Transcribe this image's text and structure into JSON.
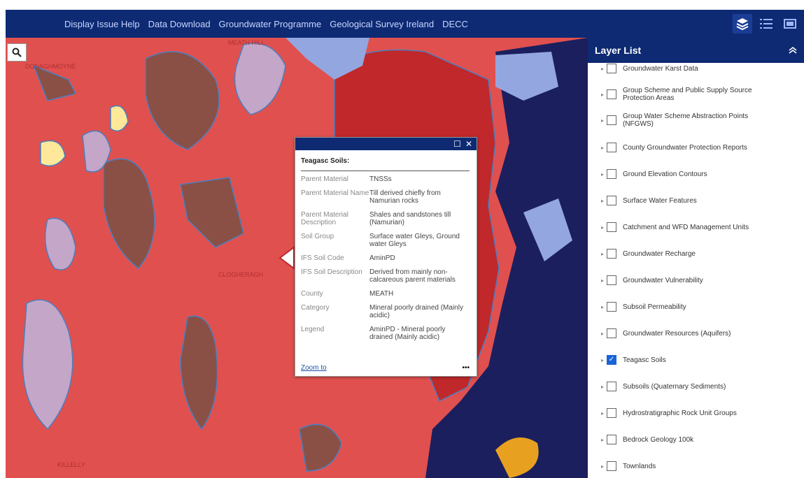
{
  "nav": {
    "links": [
      "Display Issue Help",
      "Data Download",
      "Groundwater Programme",
      "Geological Survey Ireland",
      "DECC"
    ],
    "tools": [
      "layers-icon",
      "list-icon",
      "basemap-icon"
    ]
  },
  "map": {
    "place_labels": [
      "MEATH HILL",
      "DONAGHMOYNE",
      "CLOGHERAGH",
      "KILLELLY"
    ],
    "colors": {
      "soil_red": "#e0504f",
      "soil_dark_red": "#c0282b",
      "soil_brown": "#8a5045",
      "soil_lilac": "#c4a6c8",
      "soil_yellow": "#ffe89a",
      "bedrock_navy": "#1b1f5e",
      "water_blue": "#93a6e0"
    }
  },
  "popup": {
    "title": "Teagasc Soils:",
    "rows": [
      {
        "label": "Parent Material",
        "value": "TNSSs"
      },
      {
        "label": "Parent Material Name",
        "value": "Till derived chiefly from Namurian rocks"
      },
      {
        "label": "Parent Material Description",
        "value": "Shales and sandstones till (Namurian)"
      },
      {
        "label": "Soil Group",
        "value": "Surface water Gleys, Ground water Gleys"
      },
      {
        "label": "IFS Soil Code",
        "value": "AminPD"
      },
      {
        "label": "IFS Soil Description",
        "value": "Derived from mainly non-calcareous parent materials"
      },
      {
        "label": "County",
        "value": "MEATH"
      },
      {
        "label": "Category",
        "value": "Mineral poorly drained (Mainly acidic)"
      },
      {
        "label": "Legend",
        "value": "AminPD - Mineral poorly drained (Mainly acidic)"
      }
    ],
    "zoom_label": "Zoom to",
    "more_label": "•••"
  },
  "layer_list": {
    "title": "Layer List",
    "layers": [
      {
        "name": "Groundwater Karst Data",
        "checked": false
      },
      {
        "name": "Group Scheme and Public Supply Source Protection Areas",
        "checked": false
      },
      {
        "name": "Group Water Scheme Abstraction Points (NFGWS)",
        "checked": false
      },
      {
        "name": "County Groundwater Protection Reports",
        "checked": false
      },
      {
        "name": "Ground Elevation Contours",
        "checked": false
      },
      {
        "name": "Surface Water Features",
        "checked": false
      },
      {
        "name": "Catchment and WFD Management Units",
        "checked": false
      },
      {
        "name": "Groundwater Recharge",
        "checked": false
      },
      {
        "name": "Groundwater Vulnerability",
        "checked": false
      },
      {
        "name": "Subsoil Permeability",
        "checked": false
      },
      {
        "name": "Groundwater Resources (Aquifers)",
        "checked": false
      },
      {
        "name": "Teagasc Soils",
        "checked": true
      },
      {
        "name": "Subsoils (Quaternary Sediments)",
        "checked": false
      },
      {
        "name": "Hydrostratigraphic Rock Unit Groups",
        "checked": false
      },
      {
        "name": "Bedrock Geology 100k",
        "checked": false
      },
      {
        "name": "Townlands",
        "checked": false
      }
    ]
  }
}
